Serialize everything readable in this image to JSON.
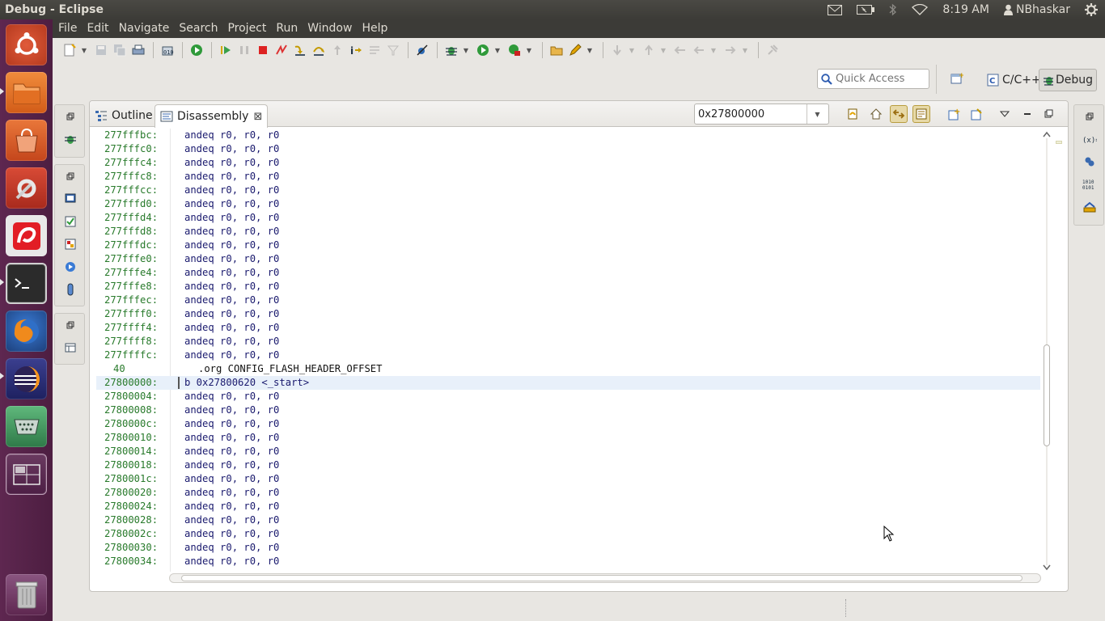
{
  "window": {
    "title": "Debug - Eclipse"
  },
  "panel": {
    "time": "8:19 AM",
    "user": "NBhaskar"
  },
  "menu": [
    "File",
    "Edit",
    "Navigate",
    "Search",
    "Project",
    "Run",
    "Window",
    "Help"
  ],
  "quick_access": {
    "placeholder": "Quick Access"
  },
  "perspectives": {
    "cpp": "C/C++",
    "debug": "Debug"
  },
  "tabs": {
    "outline": "Outline",
    "disassembly": "Disassembly",
    "close": "⊠"
  },
  "address_combo": {
    "value": "0x27800000"
  },
  "disassembly": [
    {
      "addr": "277fffbc:",
      "instr": "andeq r0, r0, r0"
    },
    {
      "addr": "277fffc0:",
      "instr": "andeq r0, r0, r0"
    },
    {
      "addr": "277fffc4:",
      "instr": "andeq r0, r0, r0"
    },
    {
      "addr": "277fffc8:",
      "instr": "andeq r0, r0, r0"
    },
    {
      "addr": "277fffcc:",
      "instr": "andeq r0, r0, r0"
    },
    {
      "addr": "277fffd0:",
      "instr": "andeq r0, r0, r0"
    },
    {
      "addr": "277fffd4:",
      "instr": "andeq r0, r0, r0"
    },
    {
      "addr": "277fffd8:",
      "instr": "andeq r0, r0, r0"
    },
    {
      "addr": "277fffdc:",
      "instr": "andeq r0, r0, r0"
    },
    {
      "addr": "277fffe0:",
      "instr": "andeq r0, r0, r0"
    },
    {
      "addr": "277fffe4:",
      "instr": "andeq r0, r0, r0"
    },
    {
      "addr": "277fffe8:",
      "instr": "andeq r0, r0, r0"
    },
    {
      "addr": "277fffec:",
      "instr": "andeq r0, r0, r0"
    },
    {
      "addr": "277ffff0:",
      "instr": "andeq r0, r0, r0"
    },
    {
      "addr": "277ffff4:",
      "instr": "andeq r0, r0, r0"
    },
    {
      "addr": "277ffff8:",
      "instr": "andeq r0, r0, r0"
    },
    {
      "addr": "277ffffc:",
      "instr": "andeq r0, r0, r0"
    },
    {
      "source_line": "40",
      "source": ".org CONFIG_FLASH_HEADER_OFFSET"
    },
    {
      "addr": "27800000:",
      "instr": "b 0x27800620 <_start>",
      "current": true
    },
    {
      "addr": "27800004:",
      "instr": "andeq r0, r0, r0"
    },
    {
      "addr": "27800008:",
      "instr": "andeq r0, r0, r0"
    },
    {
      "addr": "2780000c:",
      "instr": "andeq r0, r0, r0"
    },
    {
      "addr": "27800010:",
      "instr": "andeq r0, r0, r0"
    },
    {
      "addr": "27800014:",
      "instr": "andeq r0, r0, r0"
    },
    {
      "addr": "27800018:",
      "instr": "andeq r0, r0, r0"
    },
    {
      "addr": "2780001c:",
      "instr": "andeq r0, r0, r0"
    },
    {
      "addr": "27800020:",
      "instr": "andeq r0, r0, r0"
    },
    {
      "addr": "27800024:",
      "instr": "andeq r0, r0, r0"
    },
    {
      "addr": "27800028:",
      "instr": "andeq r0, r0, r0"
    },
    {
      "addr": "2780002c:",
      "instr": "andeq r0, r0, r0"
    },
    {
      "addr": "27800030:",
      "instr": "andeq r0, r0, r0"
    },
    {
      "addr": "27800034:",
      "instr": "andeq r0, r0, r0"
    }
  ],
  "colors": {
    "address": "#287a2b",
    "instruction": "#1a1a6e",
    "current_line": "#e8f0fa",
    "launcher": "#5e2750",
    "menubar": "#3c3b37"
  },
  "launcher_icons": [
    "ubuntu-dash-icon",
    "files-icon",
    "software-center-icon",
    "system-settings-icon",
    "airtel-icon",
    "terminal-icon",
    "firefox-icon",
    "eclipse-icon",
    "serial-terminal-icon",
    "workspace-switcher-icon",
    "trash-icon"
  ]
}
